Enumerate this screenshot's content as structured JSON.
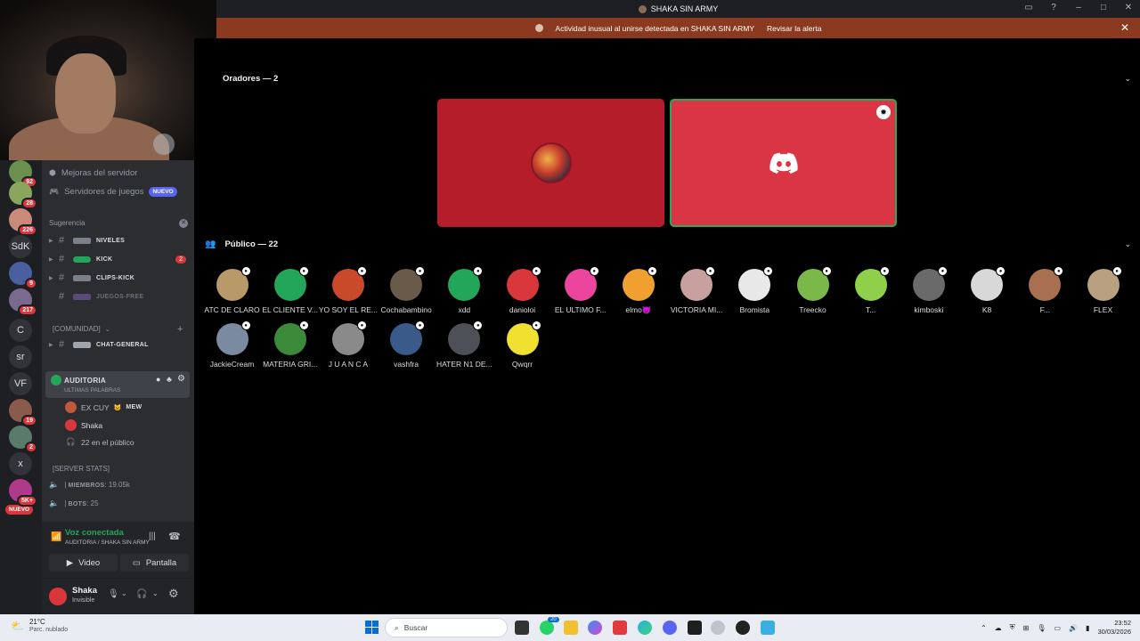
{
  "window": {
    "title": "SHAKA SIN ARMY",
    "controls": [
      "–",
      "□",
      "✕"
    ]
  },
  "alert": {
    "message": "Actividad inusual al unirse detectada en SHAKA SIN ARMY",
    "action": "Revisar la alerta",
    "close": "✕"
  },
  "guilds": [
    {
      "label": "",
      "badge": "92",
      "color": "#6a8f4e"
    },
    {
      "label": "",
      "badge": "28",
      "color": "#8aa55e"
    },
    {
      "label": "",
      "badge": "226",
      "color": "#c98a7a"
    },
    {
      "label": "SdK",
      "badge": "",
      "color": "#313338"
    },
    {
      "label": "",
      "badge": "9",
      "color": "#4a5fa0"
    },
    {
      "label": "",
      "badge": "217",
      "color": "#7a6b8e"
    },
    {
      "label": "C",
      "badge": "",
      "color": "#313338"
    },
    {
      "label": "sr",
      "badge": "",
      "color": "#313338"
    },
    {
      "label": "VF",
      "badge": "",
      "color": "#313338"
    },
    {
      "label": "",
      "badge": "19",
      "color": "#8a5a4a"
    },
    {
      "label": "",
      "badge": "2",
      "color": "#5a7a6a"
    },
    {
      "label": "x",
      "badge": "",
      "color": "#313338"
    },
    {
      "label": "",
      "badge": "5K+",
      "color": "#b03a8a"
    }
  ],
  "guild_new": "NUEVO",
  "sidebar": {
    "boosts": "Mejoras del servidor",
    "game_servers": "Servidores de juegos",
    "game_servers_tag": "NUEVO",
    "suggestion_header": "Sugerencia",
    "channels": [
      {
        "name": "NIVELES",
        "badge": "",
        "style": "strong"
      },
      {
        "name": "KICK",
        "badge": "2",
        "style": "strong"
      },
      {
        "name": "CLIPS-KICK",
        "badge": "",
        "style": "strong"
      },
      {
        "name": "JUEGOS-FREE",
        "badge": "",
        "style": "faded"
      }
    ],
    "community_category": "[COMUNIDAD]",
    "general_channel": "CHAT-GENERAL",
    "voice_channel": {
      "name": "AUDITORIA",
      "subtitle": "ULTIMAS PALABRAS",
      "users": [
        {
          "name": "EX CUY",
          "tag": "MEW"
        },
        {
          "name": "Shaka",
          "tag": ""
        }
      ],
      "audience": "22 en el público"
    },
    "stats_category": "[SERVER STATS]",
    "stats": [
      {
        "label": "MIEMBROS",
        "value": "19.05k"
      },
      {
        "label": "BOTS",
        "value": "25"
      }
    ]
  },
  "voice_connection": {
    "status": "Voz conectada",
    "location": "AUDITORIA / SHAKA SIN ARMY",
    "video_label": "Video",
    "screen_label": "Pantalla"
  },
  "user": {
    "name": "Shaka",
    "status": "Invisible"
  },
  "stage": {
    "speakers_header": "Oradores — 2",
    "audience_header": "Público — 22",
    "audience": [
      {
        "name": "ATC DE CLARO",
        "color": "#b89a6a"
      },
      {
        "name": "EL CLIENTE V...",
        "color": "#23a55a"
      },
      {
        "name": "YO SOY EL RE...",
        "color": "#c84a2a"
      },
      {
        "name": "Cochabambino",
        "color": "#6a5a4a"
      },
      {
        "name": "xdd",
        "color": "#23a55a"
      },
      {
        "name": "danioloi",
        "color": "#da373c"
      },
      {
        "name": "EL ULTIMO F...",
        "color": "#eb459e"
      },
      {
        "name": "elmo😈",
        "color": "#f0a030"
      },
      {
        "name": "VICTORIA MI...",
        "color": "#c9a0a0"
      },
      {
        "name": "Bromista",
        "color": "#e8e8e8"
      },
      {
        "name": "Treecko",
        "color": "#7ab84a"
      },
      {
        "name": "T...",
        "color": "#8ed04a"
      },
      {
        "name": "kimboski",
        "color": "#6a6a6a"
      },
      {
        "name": "K8",
        "color": "#d8d8d8"
      },
      {
        "name": "F...",
        "color": "#a87050"
      },
      {
        "name": "FLEX",
        "color": "#b8a080"
      },
      {
        "name": "JackieCream",
        "color": "#7a8aa0"
      },
      {
        "name": "MATERIA GRI...",
        "color": "#3a8a3a"
      },
      {
        "name": "J U A N C A",
        "color": "#8a8a8a"
      },
      {
        "name": "vashfra",
        "color": "#3a5a8a"
      },
      {
        "name": "HATER N1 DE...",
        "color": "#4e5058"
      },
      {
        "name": "Qwqrr",
        "color": "#f0e030"
      }
    ]
  },
  "taskbar": {
    "temperature": "21°C",
    "weather": "Parc. nublado",
    "search_placeholder": "Buscar",
    "time": "23:52",
    "date": "30/03/2026",
    "badge": "20"
  }
}
